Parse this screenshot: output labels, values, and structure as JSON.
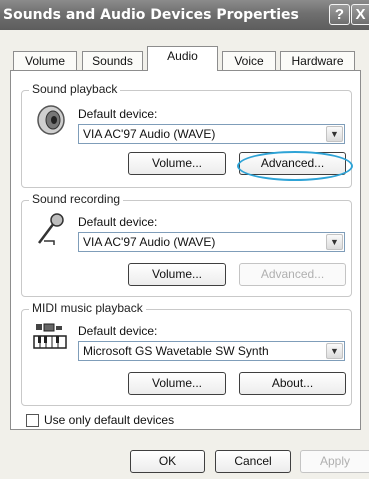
{
  "window": {
    "title": "Sounds and Audio Devices Properties",
    "help_label": "?",
    "close_label": "X"
  },
  "tabs": [
    {
      "label": "Volume"
    },
    {
      "label": "Sounds"
    },
    {
      "label": "Audio"
    },
    {
      "label": "Voice"
    },
    {
      "label": "Hardware"
    }
  ],
  "active_tab": "Audio",
  "playback": {
    "legend": "Sound playback",
    "default_label": "Default device:",
    "device": "VIA AC'97 Audio (WAVE)",
    "volume_label": "Volume...",
    "advanced_label": "Advanced..."
  },
  "recording": {
    "legend": "Sound recording",
    "default_label": "Default device:",
    "device": "VIA AC'97 Audio (WAVE)",
    "volume_label": "Volume...",
    "advanced_label": "Advanced..."
  },
  "midi": {
    "legend": "MIDI music playback",
    "default_label": "Default device:",
    "device": "Microsoft GS Wavetable SW Synth",
    "volume_label": "Volume...",
    "about_label": "About..."
  },
  "options": {
    "use_default_label": "Use only default devices",
    "use_default_checked": false
  },
  "footer": {
    "ok_label": "OK",
    "cancel_label": "Cancel",
    "apply_label": "Apply"
  },
  "icons": {
    "speaker": "speaker-icon",
    "microphone": "microphone-icon",
    "midi": "midi-keyboard-icon",
    "dropdown": "chevron-down-icon"
  },
  "colors": {
    "highlight_circle": "#2ea3d6",
    "titlebar": "#6f6f6f"
  }
}
